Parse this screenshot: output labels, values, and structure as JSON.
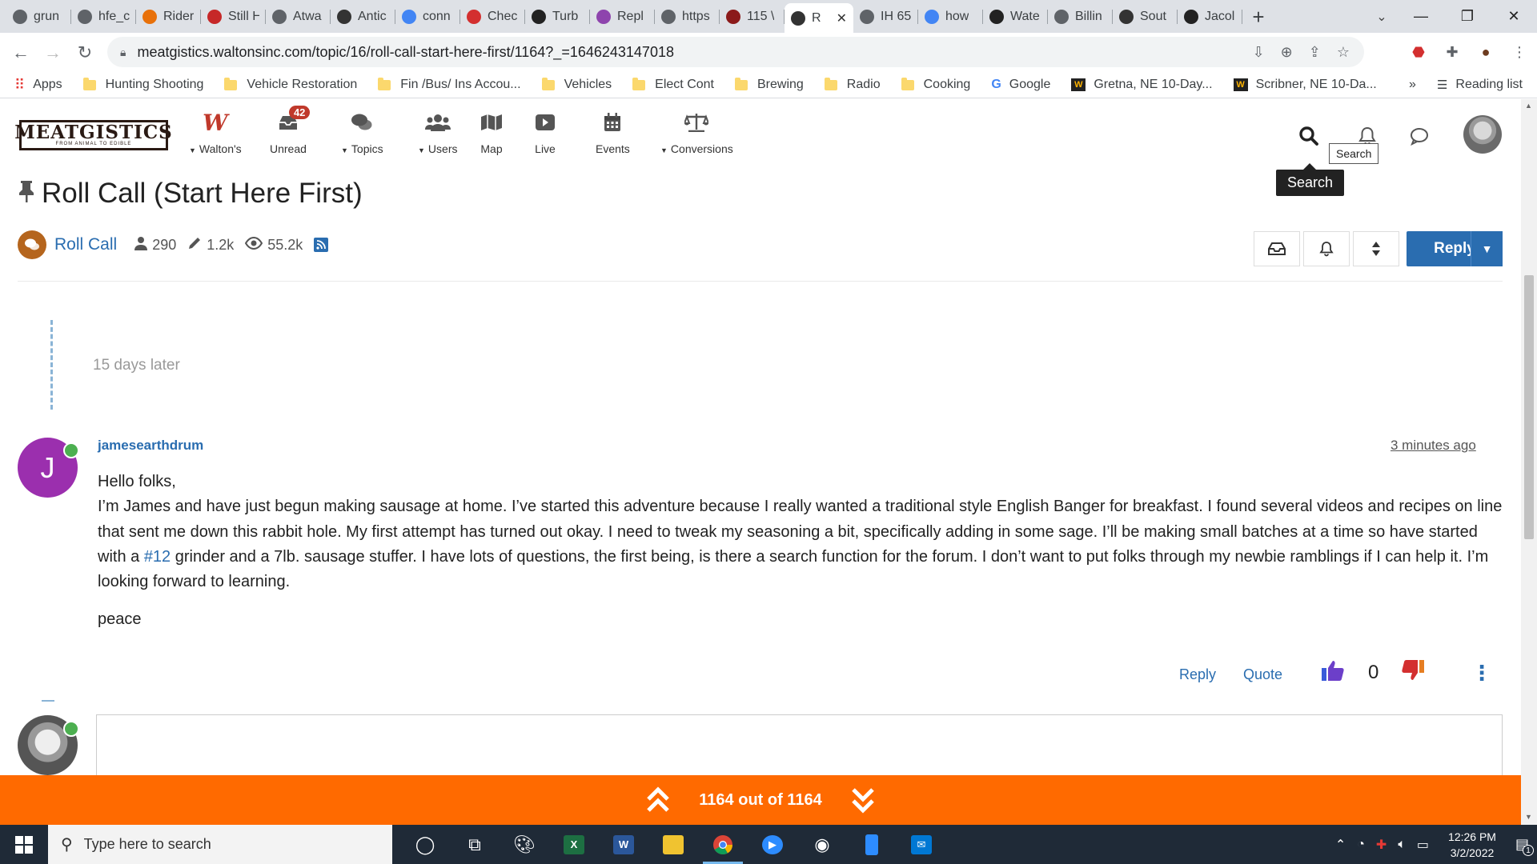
{
  "browser": {
    "tabs": [
      {
        "title": "grun",
        "icon": "globe-icon",
        "color": "#5f6368"
      },
      {
        "title": "hfe_c",
        "icon": "globe-icon",
        "color": "#5f6368"
      },
      {
        "title": "Rider",
        "icon": "riders-icon",
        "color": "#e8710a"
      },
      {
        "title": "Still H",
        "icon": "still-icon",
        "color": "#c62828"
      },
      {
        "title": "Atwa",
        "icon": "globe-icon",
        "color": "#5f6368"
      },
      {
        "title": "Antic",
        "icon": "document-icon",
        "color": "#333333"
      },
      {
        "title": "conn",
        "icon": "google-icon",
        "color": "#4285f4"
      },
      {
        "title": "Chec",
        "icon": "check-icon",
        "color": "#d32f2f"
      },
      {
        "title": "Turb",
        "icon": "turbo-icon",
        "color": "#222222"
      },
      {
        "title": "Repl",
        "icon": "calendar-icon",
        "color": "#8e44ad"
      },
      {
        "title": "https",
        "icon": "globe-icon",
        "color": "#5f6368"
      },
      {
        "title": "115 \\",
        "icon": "sc-icon",
        "color": "#8b1a1a"
      },
      {
        "title": "R",
        "icon": "meatgistics-icon",
        "color": "#333333",
        "active": true
      },
      {
        "title": "IH 65",
        "icon": "globe-icon",
        "color": "#5f6368"
      },
      {
        "title": "how",
        "icon": "google-icon",
        "color": "#4285f4"
      },
      {
        "title": "Wate",
        "icon": "weather-icon",
        "color": "#222222"
      },
      {
        "title": "Billin",
        "icon": "globe-icon",
        "color": "#5f6368"
      },
      {
        "title": "Sout",
        "icon": "south-icon",
        "color": "#333333"
      },
      {
        "title": "Jacol",
        "icon": "wikipedia-icon",
        "color": "#222222"
      }
    ],
    "url": "meatgistics.waltonsinc.com/topic/16/roll-call-start-here-first/1164?_=1646243147018",
    "bookmarks": [
      {
        "label": "Apps",
        "type": "apps"
      },
      {
        "label": "Hunting Shooting",
        "type": "folder"
      },
      {
        "label": "Vehicle Restoration",
        "type": "folder"
      },
      {
        "label": "Fin /Bus/ Ins Accou...",
        "type": "folder"
      },
      {
        "label": "Vehicles",
        "type": "folder"
      },
      {
        "label": "Elect Cont",
        "type": "folder"
      },
      {
        "label": "Brewing",
        "type": "folder"
      },
      {
        "label": "Radio",
        "type": "folder"
      },
      {
        "label": "Cooking",
        "type": "folder"
      },
      {
        "label": "Google",
        "type": "google"
      },
      {
        "label": "Gretna, NE 10-Day...",
        "type": "weather"
      },
      {
        "label": "Scribner, NE 10-Da...",
        "type": "weather"
      }
    ],
    "bookmarks_more": "»",
    "reading_list": "Reading list"
  },
  "site": {
    "logo_text": "MEATGISTICS",
    "logo_sub": "FROM ANIMAL TO EDIBLE",
    "nav": [
      {
        "label": "Walton's",
        "icon": "waltons-icon",
        "dropdown": true
      },
      {
        "label": "Unread",
        "icon": "inbox-icon",
        "badge": "42"
      },
      {
        "label": "Topics",
        "icon": "comments-icon",
        "dropdown": true
      },
      {
        "label": "Users",
        "icon": "users-icon",
        "dropdown": true
      },
      {
        "label": "Map",
        "icon": "map-icon"
      },
      {
        "label": "Live",
        "icon": "play-icon"
      },
      {
        "label": "Events",
        "icon": "calendar-icon"
      },
      {
        "label": "Conversions",
        "icon": "scale-icon",
        "dropdown": true
      }
    ],
    "tooltip_small": "Search",
    "tooltip_dark": "Search"
  },
  "topic": {
    "title": "Roll Call (Start Here First)",
    "category": "Roll Call",
    "posters": "290",
    "posts": "1.2k",
    "views": "55.2k",
    "reply_label": "Reply"
  },
  "timeline": {
    "gap_text": "15 days later"
  },
  "post": {
    "avatar_letter": "J",
    "avatar_color": "#9b2fae",
    "username": "jamesearthdrum",
    "time": "3 minutes ago",
    "greeting": "Hello folks,",
    "body_before_link": "I’m James and have just begun making sausage at home. I’ve started this adventure because I really wanted a traditional style English Banger for breakfast. I found several videos and recipes on line that sent me down this rabbit hole. My first attempt has turned out okay. I need to tweak my seasoning a bit, specifically adding in some sage. I’ll be making small batches at a time so have started with a ",
    "link_text": "#12",
    "body_after_link": " grinder and a 7lb. sausage stuffer. I have lots of questions, the first being, is there a search function for the forum. I don’t want to put folks through my newbie ramblings if I can help it. I’m looking forward to learning.",
    "signoff": "peace",
    "reply_label": "Reply",
    "quote_label": "Quote",
    "votes": "0"
  },
  "progress": {
    "text": "1164 out of 1164",
    "fraction": 1.0
  },
  "taskbar": {
    "search_placeholder": "Type here to search",
    "time": "12:26 PM",
    "date": "3/2/2022",
    "notifications": "1"
  },
  "colors": {
    "accent": "#2a6db0",
    "progress_bar": "#ff6a00",
    "badge": "#c0392b",
    "online": "#4caf50"
  }
}
